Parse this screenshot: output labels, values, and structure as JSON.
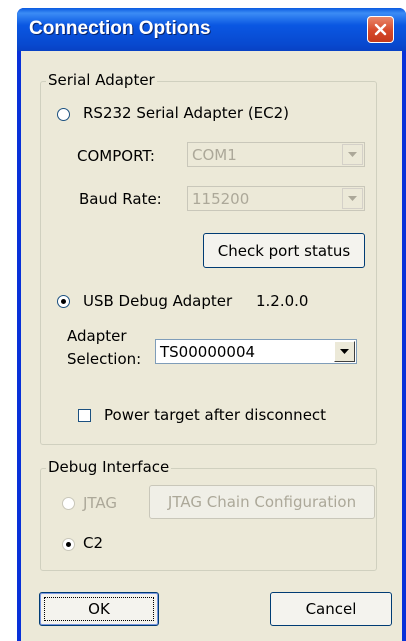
{
  "window": {
    "title": "Connection Options",
    "close_icon": "close-icon"
  },
  "serial_adapter": {
    "group_title": "Serial Adapter",
    "rs232_label": "RS232 Serial Adapter (EC2)",
    "rs232_selected": false,
    "comport_label": "COMPORT:",
    "comport_value": "COM1",
    "baud_label": "Baud Rate:",
    "baud_value": "115200",
    "check_port_label": "Check port status",
    "usb_label": "USB Debug Adapter",
    "usb_version": "1.2.0.0",
    "usb_selected": true,
    "adapter_selection_line1": "Adapter",
    "adapter_selection_line2": "Selection:",
    "adapter_value": "TS00000004",
    "power_target_label": "Power target after disconnect",
    "power_target_checked": false
  },
  "debug_interface": {
    "group_title": "Debug Interface",
    "jtag_label": "JTAG",
    "jtag_selected": false,
    "jtag_chain_label": "JTAG Chain Configuration",
    "c2_label": "C2",
    "c2_selected": true
  },
  "buttons": {
    "ok_label": "OK",
    "cancel_label": "Cancel"
  },
  "colors": {
    "title_bar": "#0a57e2",
    "dialog_bg": "#ece9d8",
    "close_button": "#d6492a",
    "disabled_text": "#aca899"
  }
}
